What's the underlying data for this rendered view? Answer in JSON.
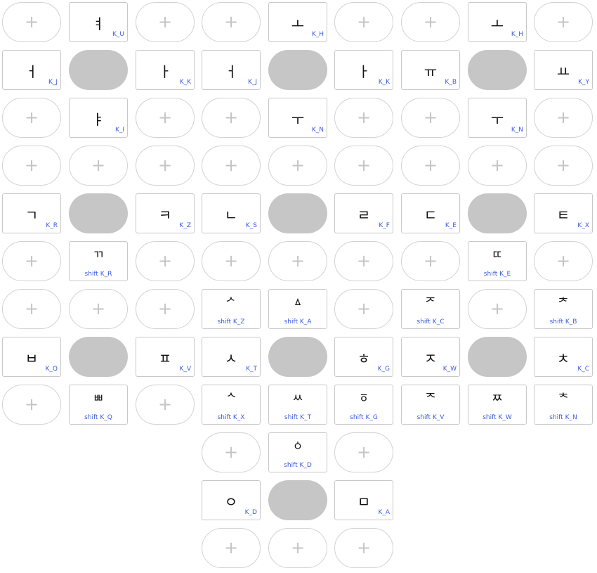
{
  "plus_glyph": "+",
  "rows": [
    [
      [
        "plus"
      ],
      [
        "key",
        "ㅕ",
        "K_U"
      ],
      [
        "plus"
      ],
      [
        "plus"
      ],
      [
        "key",
        "ㅗ",
        "K_H"
      ],
      [
        "plus"
      ],
      [
        "plus"
      ],
      [
        "key",
        "ㅗ",
        "K_H"
      ],
      [
        "plus"
      ]
    ],
    [
      [
        "key",
        "ㅓ",
        "K_J"
      ],
      [
        "center"
      ],
      [
        "key",
        "ㅏ",
        "K_K"
      ],
      [
        "key",
        "ㅓ",
        "K_J"
      ],
      [
        "center"
      ],
      [
        "key",
        "ㅏ",
        "K_K"
      ],
      [
        "key",
        "ㅠ",
        "K_B"
      ],
      [
        "center"
      ],
      [
        "key",
        "ㅛ",
        "K_Y"
      ]
    ],
    [
      [
        "plus"
      ],
      [
        "key",
        "ㅑ",
        "K_I"
      ],
      [
        "plus"
      ],
      [
        "plus"
      ],
      [
        "key",
        "ㅜ",
        "K_N"
      ],
      [
        "plus"
      ],
      [
        "plus"
      ],
      [
        "key",
        "ㅜ",
        "K_N"
      ],
      [
        "plus"
      ]
    ],
    [
      [
        "plus"
      ],
      [
        "plus"
      ],
      [
        "plus"
      ],
      [
        "plus"
      ],
      [
        "plus"
      ],
      [
        "plus"
      ],
      [
        "plus"
      ],
      [
        "plus"
      ],
      [
        "plus"
      ]
    ],
    [
      [
        "key",
        "ㄱ",
        "K_R"
      ],
      [
        "center"
      ],
      [
        "key",
        "ㅋ",
        "K_Z"
      ],
      [
        "key",
        "ㄴ",
        "K_S"
      ],
      [
        "center"
      ],
      [
        "key",
        "ㄹ",
        "K_F"
      ],
      [
        "key",
        "ㄷ",
        "K_E"
      ],
      [
        "center"
      ],
      [
        "key",
        "ㅌ",
        "K_X"
      ]
    ],
    [
      [
        "plus"
      ],
      [
        "shift",
        "ㄲ",
        "shift K_R"
      ],
      [
        "plus"
      ],
      [
        "plus"
      ],
      [
        "plus"
      ],
      [
        "plus"
      ],
      [
        "plus"
      ],
      [
        "shift",
        "ㄸ",
        "shift K_E"
      ],
      [
        "plus"
      ]
    ],
    [
      [
        "plus"
      ],
      [
        "plus"
      ],
      [
        "plus"
      ],
      [
        "shift",
        "ᄼ",
        "shift K_Z"
      ],
      [
        "shift",
        "ㅿ",
        "shift K_A"
      ],
      [
        "plus"
      ],
      [
        "shift",
        "ᅎ",
        "shift K_C"
      ],
      [
        "plus"
      ],
      [
        "shift",
        "ᅔ",
        "shift K_B"
      ]
    ],
    [
      [
        "key",
        "ㅂ",
        "K_Q"
      ],
      [
        "center"
      ],
      [
        "key",
        "ㅍ",
        "K_V"
      ],
      [
        "key",
        "ㅅ",
        "K_T"
      ],
      [
        "center"
      ],
      [
        "key",
        "ㅎ",
        "K_G"
      ],
      [
        "key",
        "ㅈ",
        "K_W"
      ],
      [
        "center"
      ],
      [
        "key",
        "ㅊ",
        "K_C"
      ]
    ],
    [
      [
        "plus"
      ],
      [
        "shift",
        "ㅃ",
        "shift K_Q"
      ],
      [
        "plus"
      ],
      [
        "shift",
        "ᄾ",
        "shift K_X"
      ],
      [
        "shift",
        "ㅆ",
        "shift K_T"
      ],
      [
        "shift",
        "ㆆ",
        "shift K_G"
      ],
      [
        "shift",
        "ᅐ",
        "shift K_V"
      ],
      [
        "shift",
        "ㅉ",
        "shift K_W"
      ],
      [
        "shift",
        "ᅕ",
        "shift K_N"
      ]
    ],
    [
      null,
      null,
      null,
      [
        "plus"
      ],
      [
        "shift",
        "ㆁ",
        "shift K_D"
      ],
      [
        "plus"
      ],
      null,
      null,
      null
    ],
    [
      null,
      null,
      null,
      [
        "key",
        "ㅇ",
        "K_D"
      ],
      [
        "center"
      ],
      [
        "key",
        "ㅁ",
        "K_A"
      ],
      null,
      null,
      null
    ],
    [
      null,
      null,
      null,
      [
        "plus"
      ],
      [
        "plus"
      ],
      [
        "plus"
      ],
      null,
      null,
      null
    ]
  ]
}
